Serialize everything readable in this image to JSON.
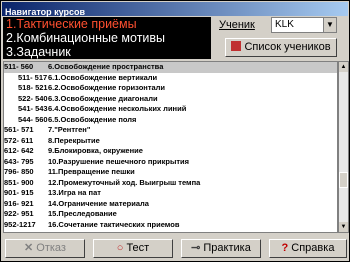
{
  "window": {
    "title": "Навигатор курсов"
  },
  "menu": [
    {
      "label": "1.Тактические приёмы"
    },
    {
      "label": "2.Комбинационные мотивы"
    },
    {
      "label": "3.Задачник"
    }
  ],
  "student": {
    "label": "Ученик",
    "value": "KLK"
  },
  "list_button": {
    "label": "Список учеников"
  },
  "rows": [
    {
      "range": "511- 560",
      "title": "6.Освобождение пространства",
      "sub": false,
      "selected": true
    },
    {
      "range": "511- 517",
      "title": "6.1.Освобождение вертикали",
      "sub": true
    },
    {
      "range": "518- 521",
      "title": "6.2.Освобождение горизонтали",
      "sub": true
    },
    {
      "range": "522- 540",
      "title": "6.3.Освобождение диагонали",
      "sub": true
    },
    {
      "range": "541- 543",
      "title": "6.4.Освобождение нескольких линий",
      "sub": true
    },
    {
      "range": "544- 560",
      "title": "6.5.Освобождение поля",
      "sub": true
    },
    {
      "range": "561- 571",
      "title": "7.\"Рентген\"",
      "sub": false
    },
    {
      "range": "572- 611",
      "title": "8.Перекрытие",
      "sub": false
    },
    {
      "range": "612- 642",
      "title": "9.Блокировка, окружение",
      "sub": false
    },
    {
      "range": "643- 795",
      "title": "10.Разрушение пешечного прикрытия",
      "sub": false
    },
    {
      "range": "796- 850",
      "title": "11.Превращение пешки",
      "sub": false
    },
    {
      "range": "851- 900",
      "title": "12.Промежуточный ход. Выигрыш темпа",
      "sub": false
    },
    {
      "range": "901- 915",
      "title": "13.Игра на пат",
      "sub": false
    },
    {
      "range": "916- 921",
      "title": "14.Ограничение материала",
      "sub": false
    },
    {
      "range": "922- 951",
      "title": "15.Преследование",
      "sub": false
    },
    {
      "range": "952-1217",
      "title": "16.Сочетание тактических приемов",
      "sub": false
    }
  ],
  "buttons": {
    "cancel": "Отказ",
    "test": "Тест",
    "practice": "Практика",
    "help": "Справка"
  }
}
